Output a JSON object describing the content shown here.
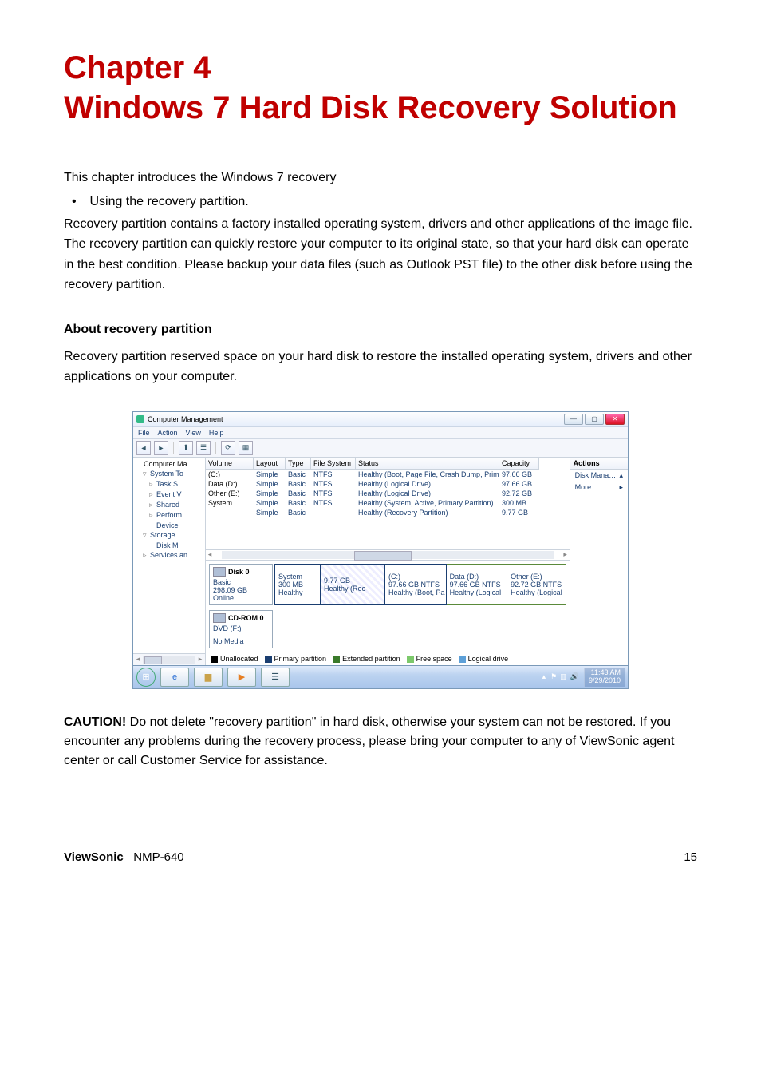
{
  "chapter": {
    "title": "Chapter 4\nWindows 7 Hard Disk Recovery Solution"
  },
  "intro": {
    "p1": "This chapter introduces the Windows 7 recovery",
    "bullet1": "Using the recovery partition.",
    "p2": "Recovery partition contains a factory installed operating system, drivers and other applications of the image file. The recovery partition can quickly restore your computer to its original state, so that your hard disk can operate in the best condition. Please backup your data files (such as Outlook PST file) to the other disk before using the recovery partition."
  },
  "about": {
    "heading": "About recovery partition",
    "p": "Recovery partition reserved space on your hard disk to restore the installed operating system, drivers and other applications on your computer."
  },
  "screenshot": {
    "window_title": "Computer Management",
    "menus": {
      "file": "File",
      "action": "Action",
      "view": "View",
      "help": "Help"
    },
    "tree": {
      "root": "Computer Ma",
      "system_tools": "System To",
      "task_sched": "Task S",
      "event_viewer": "Event V",
      "shared": "Shared",
      "perform": "Perform",
      "device": "Device",
      "storage": "Storage",
      "disk_mgmt": "Disk M",
      "services": "Services an"
    },
    "vol_headers": {
      "volume": "Volume",
      "layout": "Layout",
      "type": "Type",
      "fs": "File System",
      "status": "Status",
      "capacity": "Capacity"
    },
    "volumes": [
      {
        "name": "(C:)",
        "layout": "Simple",
        "type": "Basic",
        "fs": "NTFS",
        "status": "Healthy (Boot, Page File, Crash Dump, Primary P…",
        "capacity": "97.66 GB"
      },
      {
        "name": "Data (D:)",
        "layout": "Simple",
        "type": "Basic",
        "fs": "NTFS",
        "status": "Healthy (Logical Drive)",
        "capacity": "97.66 GB"
      },
      {
        "name": "Other (E:)",
        "layout": "Simple",
        "type": "Basic",
        "fs": "NTFS",
        "status": "Healthy (Logical Drive)",
        "capacity": "92.72 GB"
      },
      {
        "name": "System",
        "layout": "Simple",
        "type": "Basic",
        "fs": "NTFS",
        "status": "Healthy (System, Active, Primary Partition)",
        "capacity": "300 MB"
      },
      {
        "name": "",
        "layout": "Simple",
        "type": "Basic",
        "fs": "",
        "status": "Healthy (Recovery Partition)",
        "capacity": "9.77 GB"
      }
    ],
    "disk0": {
      "label": "Disk 0",
      "kind": "Basic",
      "size": "298.09 GB",
      "state": "Online",
      "parts": {
        "sys": {
          "name": "System",
          "size": "300 MB",
          "status": "Healthy"
        },
        "rec": {
          "name": "",
          "size": "9.77 GB",
          "status": "Healthy (Rec"
        },
        "c": {
          "name": "(C:)",
          "size": "97.66 GB NTFS",
          "status": "Healthy (Boot, Pa"
        },
        "d": {
          "name": "Data (D:)",
          "size": "97.66 GB NTFS",
          "status": "Healthy (Logical"
        },
        "e": {
          "name": "Other (E:)",
          "size": "92.72 GB NTFS",
          "status": "Healthy (Logical"
        }
      }
    },
    "cdrom": {
      "label": "CD-ROM 0",
      "drive": "DVD (F:)",
      "state": "No Media"
    },
    "legend": {
      "unallocated": "Unallocated",
      "primary": "Primary partition",
      "extended": "Extended partition",
      "free": "Free space",
      "logical": "Logical drive"
    },
    "actions": {
      "header": "Actions",
      "disk_mana": "Disk Mana…",
      "more": "More …"
    },
    "taskbar": {
      "time": "11:43 AM",
      "date": "9/29/2010"
    }
  },
  "caution": {
    "label": "CAUTION!",
    "text": " Do not delete \"recovery partition\" in hard disk, otherwise your system can not be restored. If you encounter any problems during the recovery process, please bring your computer to any of ViewSonic agent center or call Customer Service for assistance."
  },
  "footer": {
    "brand": "ViewSonic",
    "model": "NMP-640",
    "page": "15"
  }
}
